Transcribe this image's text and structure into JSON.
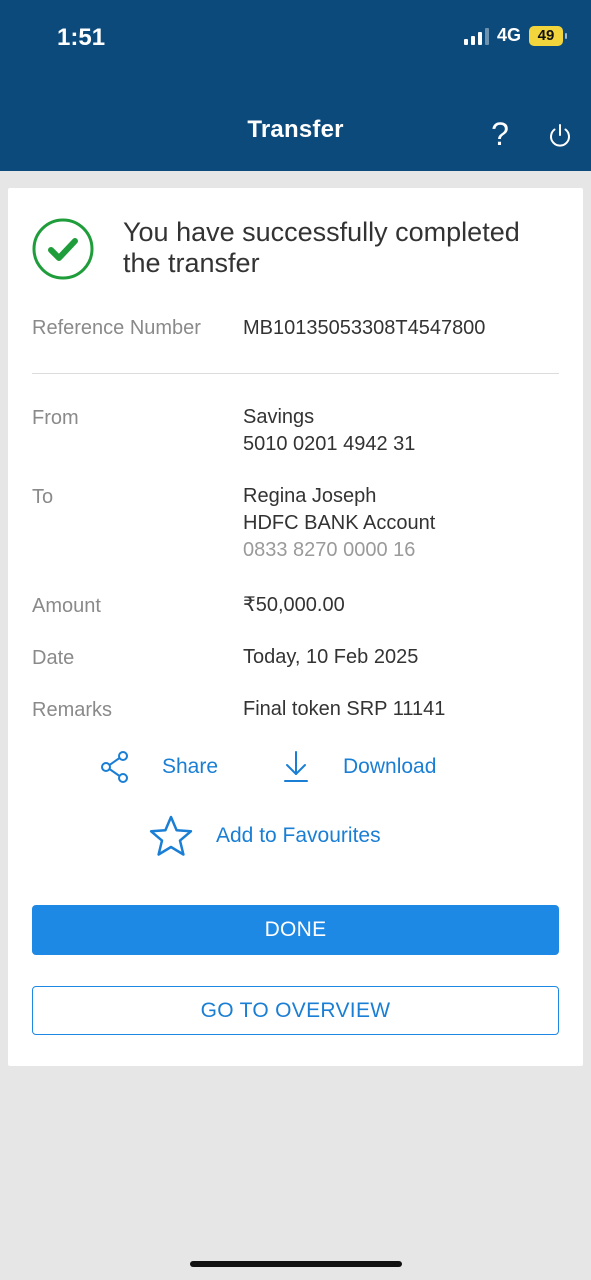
{
  "status_bar": {
    "time": "1:51",
    "network": "4G",
    "battery": "49"
  },
  "header": {
    "title": "Transfer",
    "help_label": "?",
    "background": "#0c4a7c"
  },
  "confirmation": {
    "message": "You have successfully completed the transfer",
    "icon": "check-circle-icon",
    "accent": "#1f9d3a"
  },
  "details": {
    "reference": {
      "label": "Reference Number",
      "value": "MB10135053308T4547800"
    },
    "from": {
      "label": "From",
      "account_type": "Savings",
      "account_number": "5010 0201 4942 31"
    },
    "to": {
      "label": "To",
      "name": "Regina Joseph",
      "bank": "HDFC BANK Account",
      "account_number": "0833 8270 0000 16"
    },
    "amount": {
      "label": "Amount",
      "value": "₹50,000.00"
    },
    "date": {
      "label": "Date",
      "value": "Today, 10 Feb 2025"
    },
    "remarks": {
      "label": "Remarks",
      "value": "Final token SRP 11141"
    }
  },
  "actions": {
    "share": "Share",
    "download": "Download",
    "favourite": "Add to Favourites",
    "color": "#1a7fd4"
  },
  "buttons": {
    "done": "DONE",
    "overview": "GO TO OVERVIEW",
    "primary_color": "#1e88e5"
  }
}
